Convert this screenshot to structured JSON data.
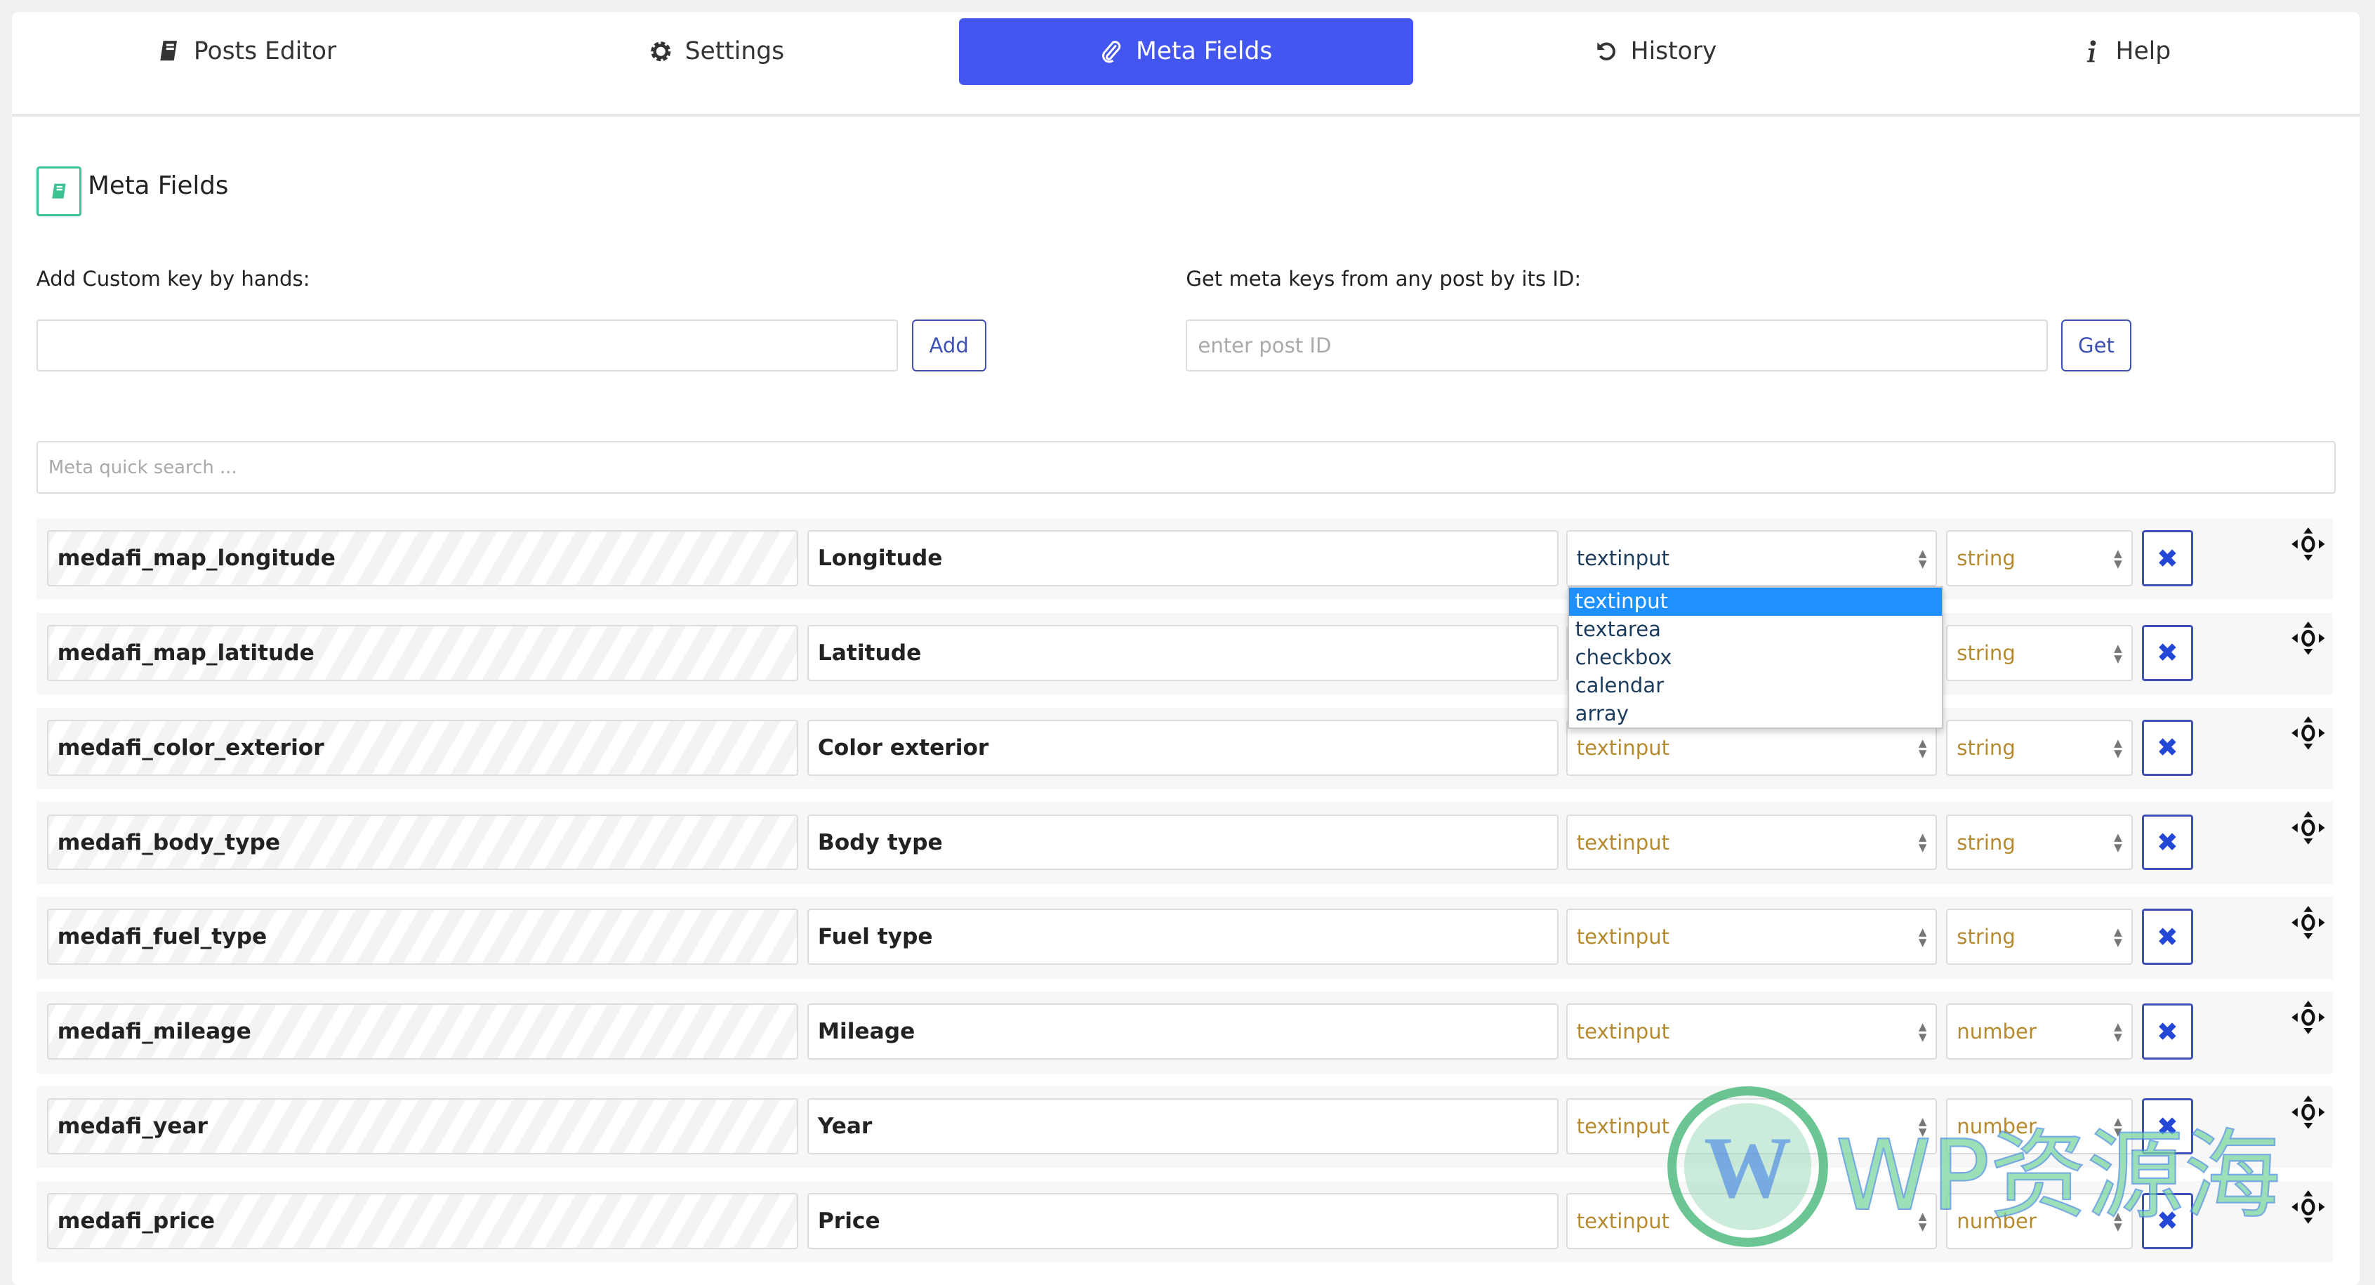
{
  "tabs": [
    {
      "label": "Posts Editor",
      "icon": "book-icon",
      "active": false
    },
    {
      "label": "Settings",
      "icon": "gear-icon",
      "active": false
    },
    {
      "label": "Meta Fields",
      "icon": "paperclip-icon",
      "active": true
    },
    {
      "label": "History",
      "icon": "undo-icon",
      "active": false
    },
    {
      "label": "Help",
      "icon": "info-icon",
      "active": false
    }
  ],
  "header": {
    "title": "Meta Fields",
    "icon": "book-icon",
    "icon_color": "#3cc391"
  },
  "custom_key": {
    "label": "Add Custom key by hands:",
    "value": "",
    "button": "Add"
  },
  "post_id": {
    "label": "Get meta keys from any post by its ID:",
    "placeholder": "enter post ID",
    "button": "Get"
  },
  "search": {
    "placeholder": "Meta quick search ..."
  },
  "colors": {
    "accent": "#4356f0",
    "select_text": "#b58a2f",
    "delete": "#2447d6"
  },
  "rows": [
    {
      "key": "medafi_map_longitude",
      "label": "Longitude",
      "type": "textinput",
      "data_type": "string"
    },
    {
      "key": "medafi_map_latitude",
      "label": "Latitude",
      "type": "textinput",
      "data_type": "string"
    },
    {
      "key": "medafi_color_exterior",
      "label": "Color exterior",
      "type": "textinput",
      "data_type": "string"
    },
    {
      "key": "medafi_body_type",
      "label": "Body type",
      "type": "textinput",
      "data_type": "string"
    },
    {
      "key": "medafi_fuel_type",
      "label": "Fuel type",
      "type": "textinput",
      "data_type": "string"
    },
    {
      "key": "medafi_mileage",
      "label": "Mileage",
      "type": "textinput",
      "data_type": "number"
    },
    {
      "key": "medafi_year",
      "label": "Year",
      "type": "textinput",
      "data_type": "number"
    },
    {
      "key": "medafi_price",
      "label": "Price",
      "type": "textinput",
      "data_type": "number"
    }
  ],
  "dropdown": {
    "open_row": 0,
    "selected": "textinput",
    "options": [
      "textinput",
      "textarea",
      "checkbox",
      "calendar",
      "array"
    ]
  },
  "watermark": "WP资源海"
}
